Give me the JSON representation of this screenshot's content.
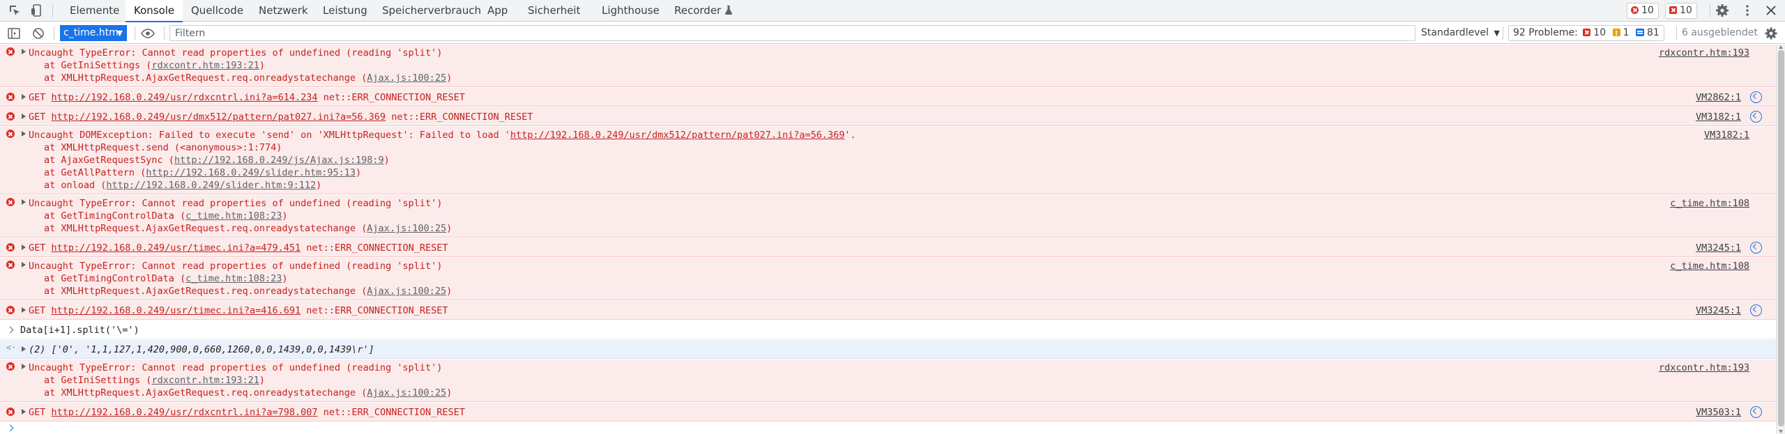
{
  "tabs": [
    "Elemente",
    "Konsole",
    "Quellcode",
    "Netzwerk",
    "Leistung",
    "Speicherverbrauch",
    "App",
    "Sicherheit",
    "Lighthouse",
    "Recorder"
  ],
  "active_tab": "Konsole",
  "counts": {
    "errors": "10",
    "issues_errors": "10"
  },
  "toolbar": {
    "context": "c_time.htm",
    "filter_placeholder": "Filtern",
    "level": "Standardlevel",
    "issues_label": "92 Probleme:",
    "issues_errors": "10",
    "issues_warnings": "1",
    "issues_info": "81",
    "hidden": "6 ausgeblendet"
  },
  "messages": [
    {
      "type": "error",
      "text": "Uncaught TypeError: Cannot read properties of undefined (reading 'split')",
      "stack": [
        [
          "at GetIniSettings (",
          "rdxcontr.htm:193:21",
          ")"
        ],
        [
          "at XMLHttpRequest.AjaxGetRequest.req.onreadystatechange (",
          "Ajax.js:100:25",
          ")"
        ]
      ],
      "source": "rdxcontr.htm:193"
    },
    {
      "type": "get",
      "method": "GET",
      "url": "http://192.168.0.249/usr/rdxcntrl.ini?a=614.234",
      "status": "net::ERR_CONNECTION_RESET",
      "source": "VM2862:1"
    },
    {
      "type": "get",
      "method": "GET",
      "url": "http://192.168.0.249/usr/dmx512/pattern/pat027.ini?a=56.369",
      "status": "net::ERR_CONNECTION_RESET",
      "source": "VM3182:1"
    },
    {
      "type": "error",
      "text_pre": "Uncaught DOMException: Failed to execute 'send' on 'XMLHttpRequest': Failed to load '",
      "text_link": "http://192.168.0.249/usr/dmx512/pattern/pat027.ini?a=56.369",
      "text_post": "'.",
      "stack": [
        [
          "at XMLHttpRequest.send (<anonymous>:1:774)",
          "",
          ""
        ],
        [
          "at AjaxGetRequestSync (",
          "http://192.168.0.249/js/Ajax.js:198:9",
          ")"
        ],
        [
          "at GetAllPattern (",
          "http://192.168.0.249/slider.htm:95:13",
          ")"
        ],
        [
          "at onload (",
          "http://192.168.0.249/slider.htm:9:112",
          ")"
        ]
      ],
      "source": "VM3182:1"
    },
    {
      "type": "error",
      "text": "Uncaught TypeError: Cannot read properties of undefined (reading 'split')",
      "stack": [
        [
          "at GetTimingControlData (",
          "c_time.htm:108:23",
          ")"
        ],
        [
          "at XMLHttpRequest.AjaxGetRequest.req.onreadystatechange (",
          "Ajax.js:100:25",
          ")"
        ]
      ],
      "source": "c_time.htm:108"
    },
    {
      "type": "get",
      "method": "GET",
      "url": "http://192.168.0.249/usr/timec.ini?a=479.451",
      "status": "net::ERR_CONNECTION_RESET",
      "source": "VM3245:1"
    },
    {
      "type": "error",
      "text": "Uncaught TypeError: Cannot read properties of undefined (reading 'split')",
      "stack": [
        [
          "at GetTimingControlData (",
          "c_time.htm:108:23",
          ")"
        ],
        [
          "at XMLHttpRequest.AjaxGetRequest.req.onreadystatechange (",
          "Ajax.js:100:25",
          ")"
        ]
      ],
      "source": "c_time.htm:108"
    },
    {
      "type": "get",
      "method": "GET",
      "url": "http://192.168.0.249/usr/timec.ini?a=416.691",
      "status": "net::ERR_CONNECTION_RESET",
      "source": "VM3245:1"
    },
    {
      "type": "input",
      "text": "Data[i+1].split('\\=')"
    },
    {
      "type": "result",
      "text": "(2) ['0', '1,1,127,1,420,900,0,660,1260,0,0,1439,0,0,1439\\r']"
    },
    {
      "type": "error",
      "text": "Uncaught TypeError: Cannot read properties of undefined (reading 'split')",
      "stack": [
        [
          "at GetIniSettings (",
          "rdxcontr.htm:193:21",
          ")"
        ],
        [
          "at XMLHttpRequest.AjaxGetRequest.req.onreadystatechange (",
          "Ajax.js:100:25",
          ")"
        ]
      ],
      "source": "rdxcontr.htm:193"
    },
    {
      "type": "get",
      "method": "GET",
      "url": "http://192.168.0.249/usr/rdxcntrl.ini?a=798.007",
      "status": "net::ERR_CONNECTION_RESET",
      "source": "VM3503:1"
    }
  ]
}
